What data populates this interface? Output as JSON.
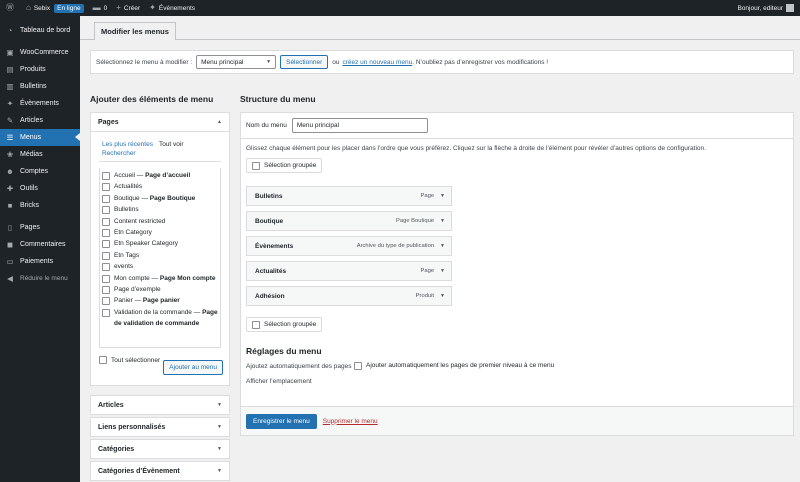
{
  "adminbar": {
    "site_name": "Sebix",
    "status_badge": "En ligne",
    "comments_count": "0",
    "new_label": "Créer",
    "events_label": "Événements",
    "greeting": "Bonjour, editeur"
  },
  "sidebar": {
    "items": [
      {
        "label": "Tableau de bord",
        "icon": "dashboard-icon",
        "glyph": "◔"
      },
      {
        "label": "WooCommerce",
        "icon": "woocommerce-icon",
        "glyph": "▣"
      },
      {
        "label": "Produits",
        "icon": "products-icon",
        "glyph": "▤"
      },
      {
        "label": "Bulletins",
        "icon": "newsletter-icon",
        "glyph": "▥"
      },
      {
        "label": "Évènements",
        "icon": "events-icon",
        "glyph": "✦"
      },
      {
        "label": "Articles",
        "icon": "pin-icon",
        "glyph": "✎"
      },
      {
        "label": "Menus",
        "icon": "menus-icon",
        "glyph": "☰"
      },
      {
        "label": "Médias",
        "icon": "media-icon",
        "glyph": "❀"
      },
      {
        "label": "Comptes",
        "icon": "users-icon",
        "glyph": "☻"
      },
      {
        "label": "Outils",
        "icon": "tools-icon",
        "glyph": "✚"
      },
      {
        "label": "Bricks",
        "icon": "bricks-icon",
        "glyph": "■"
      },
      {
        "label": "Pages",
        "icon": "pages-icon",
        "glyph": "▯"
      },
      {
        "label": "Commentaires",
        "icon": "comments-icon",
        "glyph": "◼"
      },
      {
        "label": "Paiements",
        "icon": "payments-icon",
        "glyph": "▭"
      },
      {
        "label": "Réduire le menu",
        "icon": "collapse-icon",
        "glyph": "◀"
      }
    ]
  },
  "header": {
    "tab_label": "Modifier les menus"
  },
  "manage": {
    "prompt": "Sélectionnez le menu à modifier :",
    "selected_menu": "Menu principal",
    "select_button": "Sélectionner",
    "or_text": "ou",
    "create_link": "créez un nouveau menu",
    "reminder": ". N’oubliez pas d’enregistrer vos modifications !"
  },
  "left": {
    "title": "Ajouter des éléments de menu",
    "pages_heading": "Pages",
    "tabs": [
      "Les plus récentes",
      "Tout voir",
      "Rechercher"
    ],
    "pages": [
      {
        "name": "Accueil",
        "suffix": "Page d’accueil"
      },
      {
        "name": "Actualités",
        "suffix": ""
      },
      {
        "name": "Boutique",
        "suffix": "Page Boutique"
      },
      {
        "name": "Bulletins",
        "suffix": ""
      },
      {
        "name": "Content restricted",
        "suffix": ""
      },
      {
        "name": "Etn Category",
        "suffix": ""
      },
      {
        "name": "Etn Speaker Category",
        "suffix": ""
      },
      {
        "name": "Etn Tags",
        "suffix": ""
      },
      {
        "name": "events",
        "suffix": ""
      },
      {
        "name": "Mon compte",
        "suffix": "Page Mon compte"
      },
      {
        "name": "Page d’exemple",
        "suffix": ""
      },
      {
        "name": "Panier",
        "suffix": "Page panier"
      },
      {
        "name": "Validation de la commande",
        "suffix": "Page de validation de commande"
      }
    ],
    "select_all": "Tout sélectionner",
    "add_button": "Ajouter au menu",
    "other_sections": [
      "Articles",
      "Liens personnalisés",
      "Catégories",
      "Catégories d’Évènement"
    ]
  },
  "right": {
    "title": "Structure du menu",
    "name_label": "Nom du menu",
    "name_value": "Menu principal",
    "instructions": "Glissez chaque élément pour les placer dans l’ordre que vous préférez. Cliquez sur la flèche à droite de l’élément pour révéler d’autres options de configuration.",
    "bulk_select": "Sélection groupée",
    "items": [
      {
        "title": "Bulletins",
        "type": "Page"
      },
      {
        "title": "Boutique",
        "type": "Page Boutique"
      },
      {
        "title": "Évènements",
        "type": "Archive du type de publication"
      },
      {
        "title": "Actualités",
        "type": "Page"
      },
      {
        "title": "Adhésion",
        "type": "Produit"
      }
    ],
    "settings_title": "Réglages du menu",
    "auto_add_label": "Ajoutez automatiquement des pages",
    "auto_add_value": "Ajouter automatiquement les pages de premier niveau à ce menu",
    "location_label": "Afficher l’emplacement",
    "save_button": "Enregistrer le menu",
    "delete_link": "Supprimer le menu"
  },
  "colors": {
    "accent": "#2271b1",
    "adminbar_bg": "#1d2327",
    "danger": "#b32d2e"
  }
}
